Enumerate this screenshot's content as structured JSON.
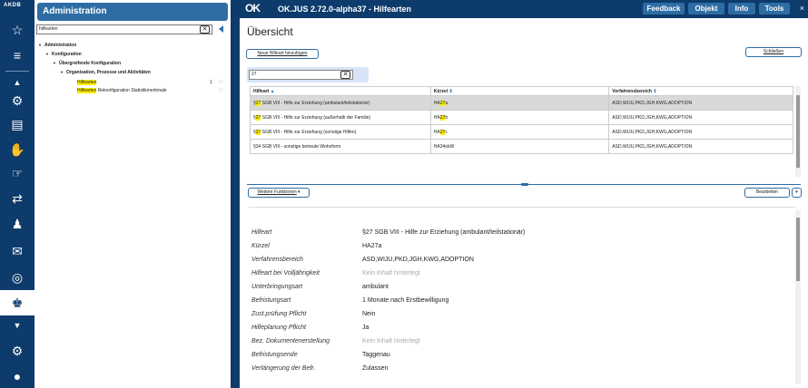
{
  "rail": {
    "logo": "AKDB",
    "icons": [
      "star-icon",
      "list-icon",
      "collapse-icon",
      "person-settings-icon",
      "document-settings-icon",
      "handshake-icon",
      "hand-icon",
      "person-transfer-icon",
      "family-icon",
      "mail-icon",
      "target-icon",
      "person-admin-icon",
      "gear-icon",
      "user-icon"
    ]
  },
  "tree": {
    "title": "Administration",
    "search_value": "hilfearten",
    "clear_label": "✕",
    "nodes": [
      {
        "label": "Administration"
      },
      {
        "label": "Konfiguration"
      },
      {
        "label": "Übergreifende Konfiguration"
      },
      {
        "label": "Organisation, Prozesse und Aktivitäten"
      }
    ],
    "leaves": [
      {
        "highlight": "Hilfearten",
        "rest": "",
        "count": "1"
      },
      {
        "highlight": "Hilfearten",
        "rest": " Rekonfiguration Statistikmerkmale",
        "count": ""
      }
    ]
  },
  "app": {
    "logo": "OK",
    "title": "OK.JUS 2.72.0-alpha37 - Hilfearten",
    "buttons": {
      "feedback": "Feedback",
      "objekt": "Objekt",
      "info": "Info",
      "tools": "Tools"
    },
    "close": "×",
    "section_title": "Übersicht",
    "add_button": "Neue Hilfeart hinzufügen",
    "close_button": "Schließen",
    "filter_value": "27",
    "filter_clear": "✕",
    "columns": {
      "hilfeart": "Hilfeart",
      "kuerzel": "Kürzel",
      "verfahren": "Verfahrensbereich"
    },
    "rows": [
      {
        "pre": "§",
        "hl": "27",
        "post": " SGB VIII - Hilfe zur Erziehung (ambulant/teilstationär)",
        "k_pre": "HA",
        "k_hl": "27",
        "k_post": "a",
        "verfahren": "ASD,WIJU,PKD,JGH,KWG,ADOPTION"
      },
      {
        "pre": "§",
        "hl": "27",
        "post": " SGB VIII - Hilfe zur Erziehung (außerhalb der Familie)",
        "k_pre": "HA",
        "k_hl": "27",
        "k_post": "b",
        "verfahren": "ASD,WIJU,PKD,JGH,KWG,ADOPTION"
      },
      {
        "pre": "§",
        "hl": "27",
        "post": " SGB VIII - Hilfe zur Erziehung (sonstige Hilfen)",
        "k_pre": "HA",
        "k_hl": "27",
        "k_post": "c",
        "verfahren": "ASD,WIJU,PKD,JGH,KWG,ADOPTION"
      },
      {
        "pre": "§34 SGB VIII - sonstige betreute Wohnform",
        "hl": "",
        "post": "",
        "k_pre": "HA34sbW",
        "k_hl": "",
        "k_post": "",
        "verfahren": "ASD,WIJU,PKD,JGH,KWG,ADOPTION"
      }
    ],
    "more_button": "Weitere Funktionen",
    "edit_button": "Bearbeiten",
    "details": [
      {
        "label": "Hilfeart",
        "value": "§27 SGB VIII - Hilfe zur Erziehung (ambulant/teilstationär)",
        "empty": false
      },
      {
        "label": "Kürzel",
        "value": "HA27a",
        "empty": false
      },
      {
        "label": "Verfahrensbereich",
        "value": "ASD,WIJU,PKD,JGH,KWG,ADOPTION",
        "empty": false
      },
      {
        "label": "Hilfeart bei Volljährigkeit",
        "value": "Kein Inhalt hinterlegt",
        "empty": true
      },
      {
        "label": "Unterbringungsart",
        "value": "ambulant",
        "empty": false
      },
      {
        "label": "Befristungsart",
        "value": "1 Monate nach Erstbewilligung",
        "empty": false
      },
      {
        "label": "Zust.prüfung Pflicht",
        "value": "Nein",
        "empty": false
      },
      {
        "label": "Hilfeplanung Pflicht",
        "value": "Ja",
        "empty": false
      },
      {
        "label": "Bez. Dokumentenerstellung",
        "value": "Kein Inhalt hinterlegt",
        "empty": true
      },
      {
        "label": "Befristungsende",
        "value": "Taggenau",
        "empty": false
      },
      {
        "label": "Verlängerung der Befr.",
        "value": "Zulassen",
        "empty": false
      }
    ]
  },
  "colors": {
    "navy": "#0d3b6b",
    "accent": "#2e6da4",
    "highlight": "#ffee00",
    "selected_row": "#d9d9d9"
  }
}
